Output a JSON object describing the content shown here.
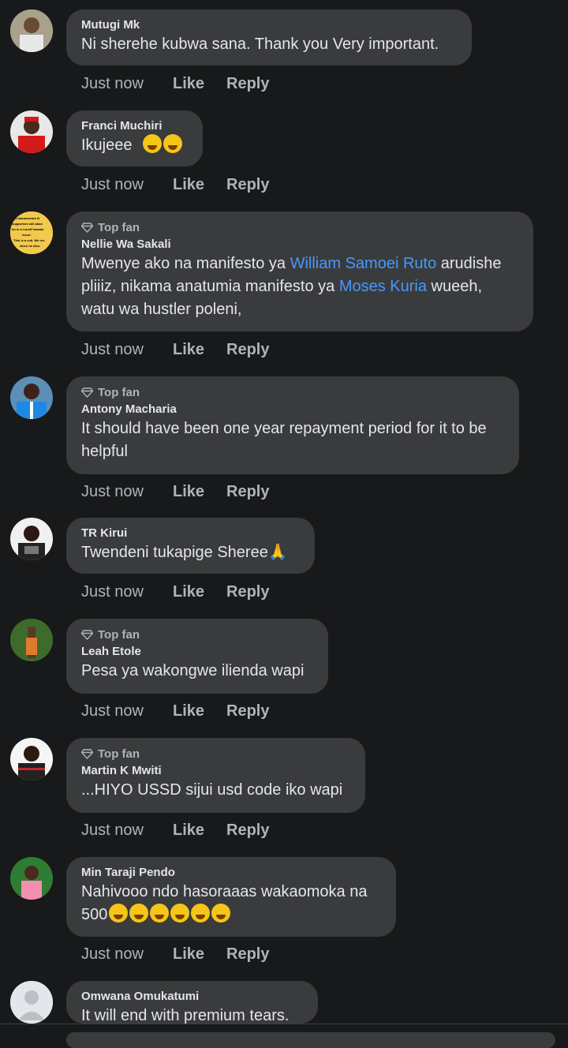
{
  "comments": [
    {
      "name": "Mutugi Mk",
      "topfan": false,
      "text": "Ni sherehe kubwa sana. Thank you Very important.",
      "time": "Just now",
      "like": "Like",
      "reply": "Reply"
    },
    {
      "name": "Franci Muchiri",
      "topfan": false,
      "text": "Ikujeee",
      "emojis": [
        "😂",
        "😂"
      ],
      "time": "Just now",
      "like": "Like",
      "reply": "Reply"
    },
    {
      "name": "Nellie Wa Sakali",
      "topfan": true,
      "text_parts": [
        "Mwenye ako na manifesto ya ",
        "William Samoei Ruto",
        " arudishe pliiiz,  nikama anatumia manifesto ya ",
        "Moses Kuria",
        " wueeh, watu wa hustler poleni,"
      ],
      "time": "Just now",
      "like": "Like",
      "reply": "Reply"
    },
    {
      "name": "Antony Macharia",
      "topfan": true,
      "text": "It should have been one year repayment period for it to be helpful",
      "time": "Just now",
      "like": "Like",
      "reply": "Reply"
    },
    {
      "name": "TR Kirui",
      "topfan": false,
      "text": "Twendeni tukapige Sheree🙏",
      "time": "Just now",
      "like": "Like",
      "reply": "Reply"
    },
    {
      "name": "Leah Etole",
      "topfan": true,
      "text": "Pesa ya wakongwe ilienda wapi",
      "time": "Just now",
      "like": "Like",
      "reply": "Reply"
    },
    {
      "name": "Martin K Mwiti",
      "topfan": true,
      "text": "...HIYO USSD sijui usd code iko wapi",
      "time": "Just now",
      "like": "Like",
      "reply": "Reply"
    },
    {
      "name": "Min Taraji Pendo",
      "topfan": false,
      "text": "Nahivooo ndo hasoraaas wakaomoka na 500",
      "emojis": [
        "🤣",
        "🤣",
        "🤣",
        "🤣",
        "🤣",
        "🤣"
      ],
      "time": "Just now",
      "like": "Like",
      "reply": "Reply"
    },
    {
      "name": "Omwana Omukatumi",
      "topfan": false,
      "text": "It will end with premium tears."
    }
  ],
  "topfan_label": "Top fan",
  "avatar_text": "Mo wanaosema hi supporters will aban tin in a runoff hawatu vizuri. This is a cult. We res when he dies."
}
